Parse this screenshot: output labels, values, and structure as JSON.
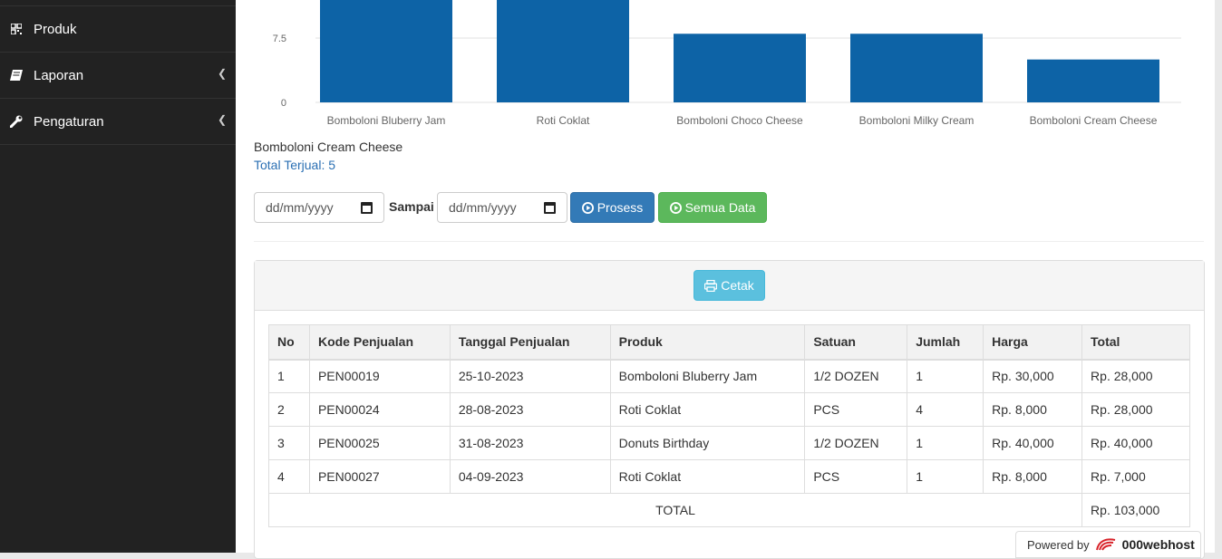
{
  "sidebar": {
    "items": [
      {
        "label": "Produk",
        "icon": "qrcode-icon",
        "has_submenu": false
      },
      {
        "label": "Laporan",
        "icon": "book-icon",
        "has_submenu": true
      },
      {
        "label": "Pengaturan",
        "icon": "wrench-icon",
        "has_submenu": true
      }
    ]
  },
  "chart_data": {
    "type": "bar",
    "categories": [
      "Bomboloni Bluberry Jam",
      "Roti Coklat",
      "Bomboloni Choco Cheese",
      "Bomboloni Milky Cream",
      "Bomboloni Cream Cheese"
    ],
    "values": [
      12,
      12,
      8,
      8,
      5
    ],
    "yticks": [
      "0",
      "7.5"
    ],
    "ylim": [
      0,
      15
    ],
    "color": "#0d63a6",
    "grid": true
  },
  "tooltip": {
    "product": "Bomboloni Cream Cheese",
    "total": "Total Terjual: 5"
  },
  "filter": {
    "date_from_placeholder": "dd/mm/yyyy",
    "sampai_label": "Sampai",
    "date_to_placeholder": "dd/mm/yyyy",
    "prosess_label": "Prosess",
    "semua_label": "Semua Data"
  },
  "panel": {
    "cetak_label": "Cetak"
  },
  "table": {
    "headers": [
      "No",
      "Kode Penjualan",
      "Tanggal Penjualan",
      "Produk",
      "Satuan",
      "Jumlah",
      "Harga",
      "Total"
    ],
    "rows": [
      [
        "1",
        "PEN00019",
        "25-10-2023",
        "Bomboloni Bluberry Jam",
        "1/2 DOZEN",
        "1",
        "Rp. 30,000",
        "Rp. 28,000"
      ],
      [
        "2",
        "PEN00024",
        "28-08-2023",
        "Roti Coklat",
        "PCS",
        "4",
        "Rp. 8,000",
        "Rp. 28,000"
      ],
      [
        "3",
        "PEN00025",
        "31-08-2023",
        "Donuts Birthday",
        "1/2 DOZEN",
        "1",
        "Rp. 40,000",
        "Rp. 40,000"
      ],
      [
        "4",
        "PEN00027",
        "04-09-2023",
        "Roti Coklat",
        "PCS",
        "1",
        "Rp. 8,000",
        "Rp. 7,000"
      ]
    ],
    "total_label": "TOTAL",
    "total_value": "Rp. 103,000"
  },
  "footer": {
    "powered_by": "Powered by",
    "brand": "000webhost"
  }
}
